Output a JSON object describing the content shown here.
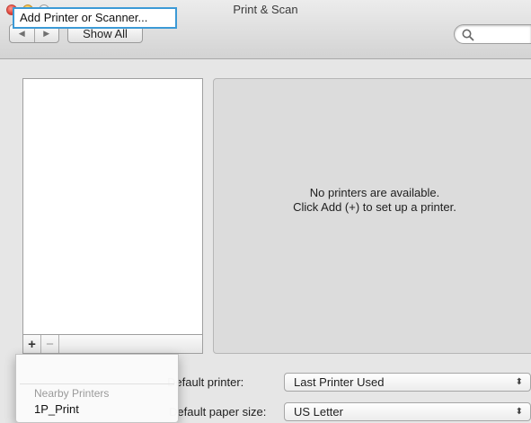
{
  "window": {
    "title": "Print & Scan"
  },
  "toolbar": {
    "back_icon": "left-arrow-icon",
    "forward_icon": "right-arrow-icon",
    "back_glyph": "◀",
    "forward_glyph": "▶",
    "show_all_label": "Show All",
    "search_placeholder": ""
  },
  "printer_list": {
    "items": [],
    "add_glyph": "+",
    "remove_glyph": "−"
  },
  "detail": {
    "line1": "No printers are available.",
    "line2": "Click Add (+) to set up a printer."
  },
  "settings": {
    "default_printer_label": "Default printer:",
    "default_printer_value": "Last Printer Used",
    "paper_size_label": "Default paper size:",
    "paper_size_value": "US Letter",
    "popup_arrows": "⬍"
  },
  "add_menu": {
    "add_label": "Add Printer or Scanner...",
    "section_header": "Nearby Printers",
    "items": [
      "1P_Print"
    ]
  },
  "colors": {
    "focus_ring": "#3c9ad6",
    "close": "#e0443b",
    "minimize": "#f1b53a"
  }
}
